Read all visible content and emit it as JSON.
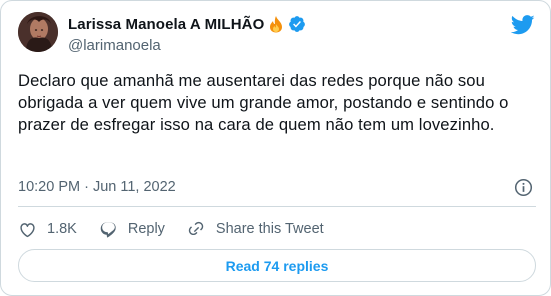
{
  "author": {
    "display_name": "Larissa Manoela A MILHÃO",
    "handle": "@larimanoela"
  },
  "icons": {
    "name_emoji": "fire-icon",
    "verified": "verified-badge-icon",
    "brand": "twitter-bird-icon",
    "info": "info-icon"
  },
  "tweet": {
    "text": "Declaro que amanhã me ausentarei das redes porque não sou obrigada a ver quem vive um grande amor, postando e sentindo o prazer de esfregar isso na cara de quem não tem um lovezinho.",
    "timestamp": "10:20 PM · Jun 11, 2022"
  },
  "actions": {
    "like_count": "1.8K",
    "reply_label": "Reply",
    "share_label": "Share this Tweet"
  },
  "footer": {
    "replies_label": "Read 74 replies"
  },
  "colors": {
    "accent": "#1d9bf0",
    "text_primary": "#0f1419",
    "text_secondary": "#536471",
    "border": "#cfd9de"
  }
}
